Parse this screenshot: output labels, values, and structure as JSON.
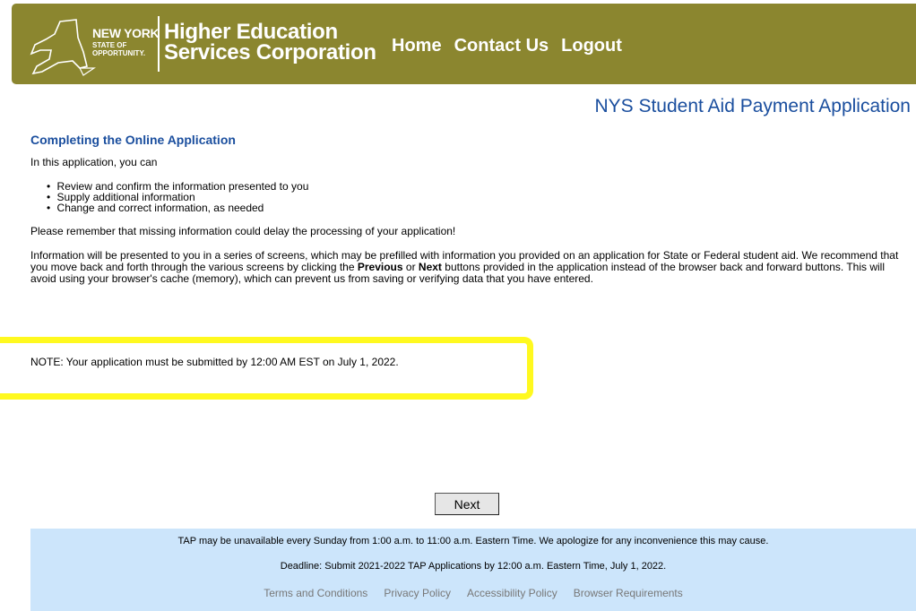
{
  "header": {
    "logo_line1": "NEW YORK",
    "logo_line2a": "STATE OF",
    "logo_line2b": "OPPORTUNITY.",
    "agency_line1": "Higher Education",
    "agency_line2": "Services Corporation",
    "nav": [
      "Home",
      "Contact Us",
      "Logout"
    ],
    "brand_color": "#8b862f"
  },
  "app_title": "NYS Student Aid Payment Application",
  "main": {
    "section_title": "Completing the Online Application",
    "intro": "In this application, you can",
    "bullets": [
      "Review and confirm the information presented to you",
      "Supply additional information",
      "Change and correct information, as needed"
    ],
    "reminder": "Please remember that missing information could delay the processing of your application!",
    "info_part1": "Information will be presented to you in a series of screens, which may be prefilled with information you provided on an application for State or Federal student aid. We recommend that you move back and forth through the various screens by clicking the ",
    "info_previous": "Previous",
    "info_or": " or ",
    "info_next": "Next",
    "info_part2": " buttons provided in the application instead of the browser back and forward buttons. This will avoid using your browser's cache (memory), which can prevent us from saving or verifying data that you have entered.",
    "note": "NOTE: Your application must be submitted by 12:00 AM EST on July 1, 2022.",
    "highlight_color": "#fff91f"
  },
  "next_button": "Next",
  "footer": {
    "line1": "TAP may be unavailable every Sunday from 1:00 a.m. to 11:00 a.m. Eastern Time. We apologize for any inconvenience this may cause.",
    "line2": "Deadline: Submit 2021-2022 TAP Applications by 12:00 a.m. Eastern Time, July 1, 2022.",
    "links": [
      "Terms and Conditions",
      "Privacy Policy",
      "Accessibility Policy",
      "Browser Requirements"
    ],
    "bg_color": "#cce5fb"
  }
}
